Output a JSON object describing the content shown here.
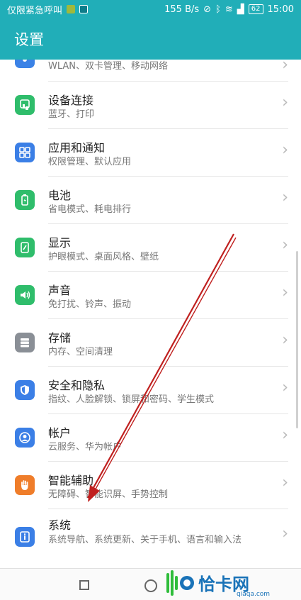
{
  "status_bar": {
    "carrier": "仅限紧急呼叫",
    "speed": "155 B/s",
    "battery": "62",
    "time": "15:00"
  },
  "header": {
    "title": "设置"
  },
  "items": [
    {
      "title": "",
      "subtitle": "WLAN、双卡管理、移动网络",
      "icon": "network-icon",
      "color": "#3b82e6"
    },
    {
      "title": "设备连接",
      "subtitle": "蓝牙、打印",
      "icon": "device-connect-icon",
      "color": "#2fbd6b"
    },
    {
      "title": "应用和通知",
      "subtitle": "权限管理、默认应用",
      "icon": "apps-icon",
      "color": "#3b7fe6"
    },
    {
      "title": "电池",
      "subtitle": "省电模式、耗电排行",
      "icon": "battery-icon",
      "color": "#2fbd6b"
    },
    {
      "title": "显示",
      "subtitle": "护眼模式、桌面风格、壁纸",
      "icon": "display-icon",
      "color": "#2fbd6b"
    },
    {
      "title": "声音",
      "subtitle": "免打扰、铃声、振动",
      "icon": "sound-icon",
      "color": "#2fbd6b"
    },
    {
      "title": "存储",
      "subtitle": "内存、空间清理",
      "icon": "storage-icon",
      "color": "#8a8f96"
    },
    {
      "title": "安全和隐私",
      "subtitle": "指纹、人脸解锁、锁屏和密码、学生模式",
      "icon": "security-icon",
      "color": "#3b7fe6"
    },
    {
      "title": "帐户",
      "subtitle": "云服务、华为帐户",
      "icon": "account-icon",
      "color": "#3b7fe6"
    },
    {
      "title": "智能辅助",
      "subtitle": "无障碍、智能识屏、手势控制",
      "icon": "smart-assist-icon",
      "color": "#ef7d2a"
    },
    {
      "title": "系统",
      "subtitle": "系统导航、系统更新、关于手机、语言和输入法",
      "icon": "system-icon",
      "color": "#3b7fe6"
    }
  ],
  "watermark": {
    "text": "恰卡网",
    "sub": "qiaqa.com"
  }
}
